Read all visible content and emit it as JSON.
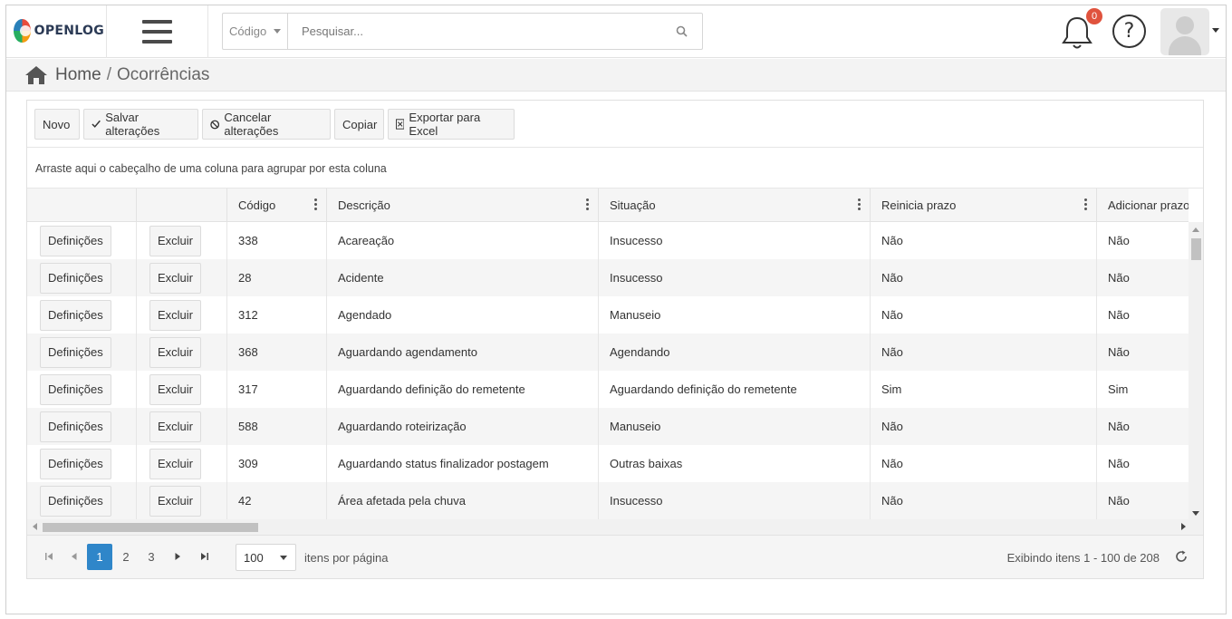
{
  "app": {
    "logo_text": "OPENLOG"
  },
  "search": {
    "field_select": "Código",
    "placeholder": "Pesquisar..."
  },
  "notifications": {
    "count": "0"
  },
  "help": {
    "label": "?"
  },
  "breadcrumb": {
    "home": "Home",
    "separator": "/",
    "current": "Ocorrências"
  },
  "toolbar": {
    "new": "Novo",
    "save": "Salvar alterações",
    "cancel": "Cancelar alterações",
    "copy": "Copiar",
    "export": "Exportar para Excel"
  },
  "group_hint": "Arraste aqui o cabeçalho de uma coluna para agrupar por esta coluna",
  "columns": {
    "codigo": "Código",
    "descricao": "Descrição",
    "situacao": "Situação",
    "reinicia": "Reinicia prazo",
    "adicionar": "Adicionar prazo"
  },
  "row_actions": {
    "definitions": "Definições",
    "delete": "Excluir"
  },
  "rows": [
    {
      "codigo": "338",
      "descricao": "Acareação",
      "situacao": "Insucesso",
      "reinicia": "Não",
      "adicionar": "Não"
    },
    {
      "codigo": "28",
      "descricao": "Acidente",
      "situacao": "Insucesso",
      "reinicia": "Não",
      "adicionar": "Não"
    },
    {
      "codigo": "312",
      "descricao": "Agendado",
      "situacao": "Manuseio",
      "reinicia": "Não",
      "adicionar": "Não"
    },
    {
      "codigo": "368",
      "descricao": "Aguardando agendamento",
      "situacao": "Agendando",
      "reinicia": "Não",
      "adicionar": "Não"
    },
    {
      "codigo": "317",
      "descricao": "Aguardando definição do remetente",
      "situacao": "Aguardando definição do remetente",
      "reinicia": "Sim",
      "adicionar": "Sim"
    },
    {
      "codigo": "588",
      "descricao": "Aguardando roteirização",
      "situacao": "Manuseio",
      "reinicia": "Não",
      "adicionar": "Não"
    },
    {
      "codigo": "309",
      "descricao": "Aguardando status finalizador postagem",
      "situacao": "Outras baixas",
      "reinicia": "Não",
      "adicionar": "Não"
    },
    {
      "codigo": "42",
      "descricao": "Área afetada pela chuva",
      "situacao": "Insucesso",
      "reinicia": "Não",
      "adicionar": "Não"
    }
  ],
  "pager": {
    "pages": [
      "1",
      "2",
      "3"
    ],
    "active_page": "1",
    "page_size": "100",
    "page_size_label": "itens por página",
    "info": "Exibindo itens 1 - 100 de 208"
  },
  "colors": {
    "accent": "#2f86c9",
    "badge": "#e0533d"
  }
}
